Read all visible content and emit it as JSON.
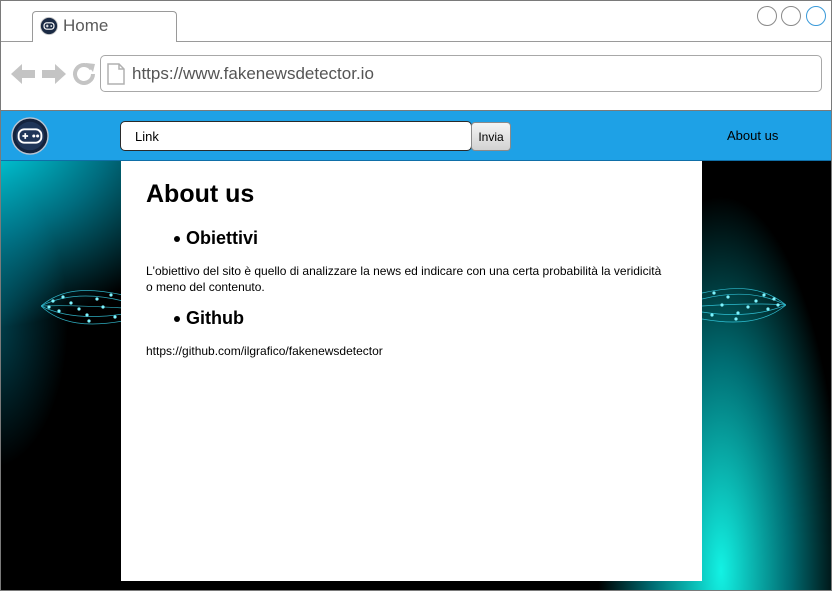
{
  "browser": {
    "tab": {
      "label": "Home"
    },
    "url": "https://www.fakenewsdetector.io",
    "window_controls": [
      "circle",
      "circle",
      "circle-active"
    ],
    "icons": [
      "back-arrow-icon",
      "forward-arrow-icon",
      "reload-icon",
      "page-icon"
    ]
  },
  "site": {
    "header": {
      "search_value": "Link",
      "submit_label": "Invia",
      "nav_about": "About us",
      "background_color": "#1ea1e6"
    },
    "content": {
      "title": "About us",
      "sections": [
        {
          "heading": "Obiettivi",
          "text": "L'obiettivo del sito è quello di analizzare la news ed indicare con una certa probabilità la veridicità o meno del contenuto."
        },
        {
          "heading": "Github",
          "text": "https://github.com/ilgrafico/fakenewsdetector"
        }
      ]
    },
    "background_accent": "#00e5ff"
  }
}
